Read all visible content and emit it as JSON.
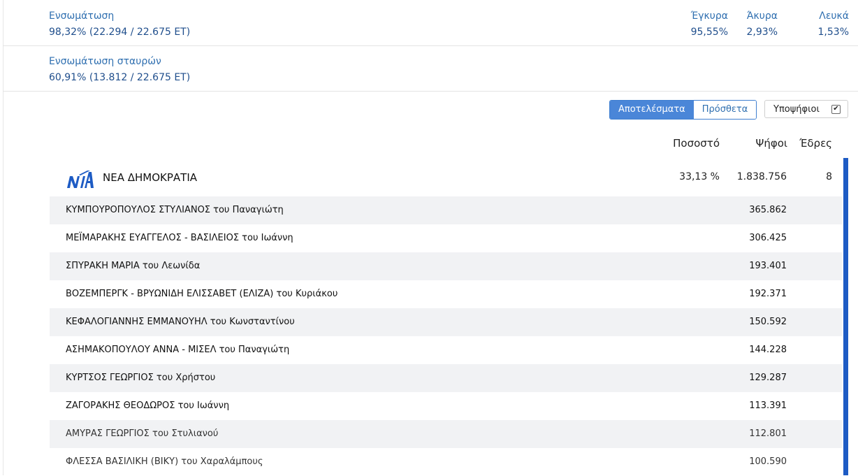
{
  "ensomatosi": {
    "label": "Ενσωμάτωση",
    "value": "98,32% (22.294 / 22.675 ΕΤ)"
  },
  "quality": [
    {
      "label": "Έγκυρα",
      "value": "95,55%"
    },
    {
      "label": "Άκυρα",
      "value": "2,93%"
    },
    {
      "label": "Λευκά",
      "value": "1,53%"
    }
  ],
  "crosses": {
    "label": "Ενσωμάτωση σταυρών",
    "value": "60,91% (13.812 / 22.675 ΕΤ)"
  },
  "tabs": {
    "results": "Αποτελέσματα",
    "sums": "Πρόσθετα"
  },
  "candidates_toggle": {
    "label": "Υποψήφιοι",
    "checked_glyph": "✔"
  },
  "columns": {
    "pct": "Ποσοστό",
    "votes": "Ψήφοι",
    "seats": "Έδρες"
  },
  "party": {
    "name": "ΝΕΑ ΔΗΜΟΚΡΑΤΙΑ",
    "pct": "33,13 %",
    "votes": "1.838.756",
    "seats": "8",
    "logo_icon": "nd-party-logo",
    "logo_color": "#1d5bc4"
  },
  "accent_color": "#1d5bc4",
  "candidates": [
    {
      "name": "ΚΥΜΠΟΥΡΟΠΟΥΛΟΣ ΣΤΥΛΙΑΝΟΣ του Παναγιώτη",
      "votes": "365.862"
    },
    {
      "name": "ΜΕΪΜΑΡΑΚΗΣ ΕΥΑΓΓΕΛΟΣ - ΒΑΣΙΛΕΙΟΣ του Ιωάννη",
      "votes": "306.425"
    },
    {
      "name": "ΣΠΥΡΑΚΗ ΜΑΡΙΑ του Λεωνίδα",
      "votes": "193.401"
    },
    {
      "name": "ΒΟΖΕΜΠΕΡΓΚ - ΒΡΥΩΝΙΔΗ ΕΛΙΣΣΑΒΕΤ (ΕΛΙΖΑ) του Κυριάκου",
      "votes": "192.371"
    },
    {
      "name": "ΚΕΦΑΛΟΓΙΑΝΝΗΣ ΕΜΜΑΝΟΥΗΛ του Κωνσταντίνου",
      "votes": "150.592"
    },
    {
      "name": "ΑΣΗΜΑΚΟΠΟΥΛΟΥ ΑΝΝΑ - ΜΙΣΕΛ του Παναγιώτη",
      "votes": "144.228"
    },
    {
      "name": "ΚΥΡΤΣΟΣ ΓΕΩΡΓΙΟΣ του Χρήστου",
      "votes": "129.287"
    },
    {
      "name": "ΖΑΓΟΡΑΚΗΣ ΘΕΟΔΩΡΟΣ του Ιωάννη",
      "votes": "113.391"
    },
    {
      "name": "ΑΜΥΡΑΣ ΓΕΩΡΓΙΟΣ του Στυλιανού",
      "votes": "112.801"
    },
    {
      "name": "ΦΛΕΣΣΑ ΒΑΣΙΛΙΚΗ (ΒΙΚΥ) του Χαραλάμπους",
      "votes": "100.590"
    }
  ]
}
